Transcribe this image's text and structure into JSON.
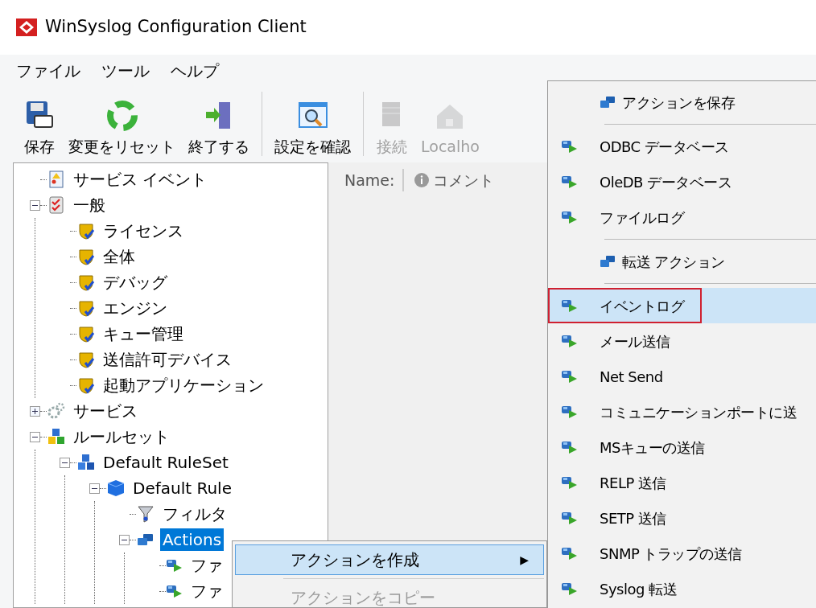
{
  "window": {
    "title": "WinSyslog Configuration Client"
  },
  "menu_bar": [
    "ファイル",
    "ツール",
    "ヘルプ"
  ],
  "toolbar": [
    {
      "kind": "save",
      "label": "保存",
      "disabled": false
    },
    {
      "kind": "reset",
      "label": "変更をリセット",
      "disabled": false
    },
    {
      "kind": "exit",
      "label": "終了する",
      "disabled": false
    },
    {
      "kind": "separator"
    },
    {
      "kind": "check",
      "label": "設定を確認",
      "disabled": false
    },
    {
      "kind": "separator"
    },
    {
      "kind": "connect",
      "label": "接続",
      "disabled": true
    },
    {
      "kind": "home",
      "label": "Localho",
      "disabled": true
    }
  ],
  "tree": [
    {
      "kind": "event",
      "label": "サービス イベント",
      "selected": false
    },
    {
      "kind": "general",
      "label": "一般",
      "selected": false,
      "expanded": true,
      "children": [
        {
          "kind": "setting",
          "label": "ライセンス",
          "selected": false
        },
        {
          "kind": "setting",
          "label": "全体",
          "selected": false
        },
        {
          "kind": "setting",
          "label": "デバッグ",
          "selected": false
        },
        {
          "kind": "setting",
          "label": "エンジン",
          "selected": false
        },
        {
          "kind": "setting",
          "label": "キュー管理",
          "selected": false
        },
        {
          "kind": "setting",
          "label": "送信許可デバイス",
          "selected": false
        },
        {
          "kind": "setting",
          "label": "起動アプリケーション",
          "selected": false
        }
      ]
    },
    {
      "kind": "service",
      "label": "サービス",
      "selected": false,
      "expanded": false
    },
    {
      "kind": "rulesets",
      "label": "ルールセット",
      "selected": false,
      "expanded": true,
      "children": [
        {
          "kind": "ruleset",
          "label": "Default RuleSet",
          "selected": false,
          "expanded": true,
          "children": [
            {
              "kind": "rule",
              "label": "Default Rule",
              "selected": false,
              "expanded": true,
              "children": [
                {
                  "kind": "filter",
                  "label": "フィルタ",
                  "selected": false
                },
                {
                  "kind": "actions",
                  "label": "Actions",
                  "selected": true,
                  "expanded": true,
                  "children": [
                    {
                      "kind": "action",
                      "label": "ファ",
                      "selected": false
                    },
                    {
                      "kind": "action",
                      "label": "ファ",
                      "selected": false
                    }
                  ]
                }
              ]
            }
          ]
        }
      ]
    }
  ],
  "pane_header": {
    "name_label": "Name:",
    "comment_label": "コメント"
  },
  "context_menu": [
    {
      "kind": "submenu",
      "label": "アクションを作成",
      "arrow": "▶",
      "selected": true,
      "disabled": false
    },
    {
      "kind": "separator"
    },
    {
      "kind": "item",
      "label": "アクションをコピー",
      "selected": false,
      "disabled": true
    }
  ],
  "submenu": [
    {
      "kind": "header",
      "label": "アクションを保存",
      "selected": false,
      "outlined": false
    },
    {
      "kind": "separator"
    },
    {
      "kind": "action",
      "label": "ODBC データベース",
      "selected": false,
      "outlined": false
    },
    {
      "kind": "action",
      "label": "OleDB データベース",
      "selected": false,
      "outlined": false
    },
    {
      "kind": "action",
      "label": "ファイルログ",
      "selected": false,
      "outlined": false
    },
    {
      "kind": "separator"
    },
    {
      "kind": "header",
      "label": "転送 アクション",
      "selected": false,
      "outlined": false
    },
    {
      "kind": "separator"
    },
    {
      "kind": "action",
      "label": "イベントログ",
      "selected": true,
      "outlined": true
    },
    {
      "kind": "action",
      "label": "メール送信",
      "selected": false,
      "outlined": false
    },
    {
      "kind": "action",
      "label": "Net Send",
      "selected": false,
      "outlined": false
    },
    {
      "kind": "action",
      "label": "コミュニケーションポートに送",
      "selected": false,
      "outlined": false
    },
    {
      "kind": "action",
      "label": "MSキューの送信",
      "selected": false,
      "outlined": false
    },
    {
      "kind": "action",
      "label": "RELP 送信",
      "selected": false,
      "outlined": false
    },
    {
      "kind": "action",
      "label": "SETP 送信",
      "selected": false,
      "outlined": false
    },
    {
      "kind": "action",
      "label": "SNMP トラップの送信",
      "selected": false,
      "outlined": false
    },
    {
      "kind": "action",
      "label": "Syslog 転送",
      "selected": false,
      "outlined": false
    }
  ]
}
